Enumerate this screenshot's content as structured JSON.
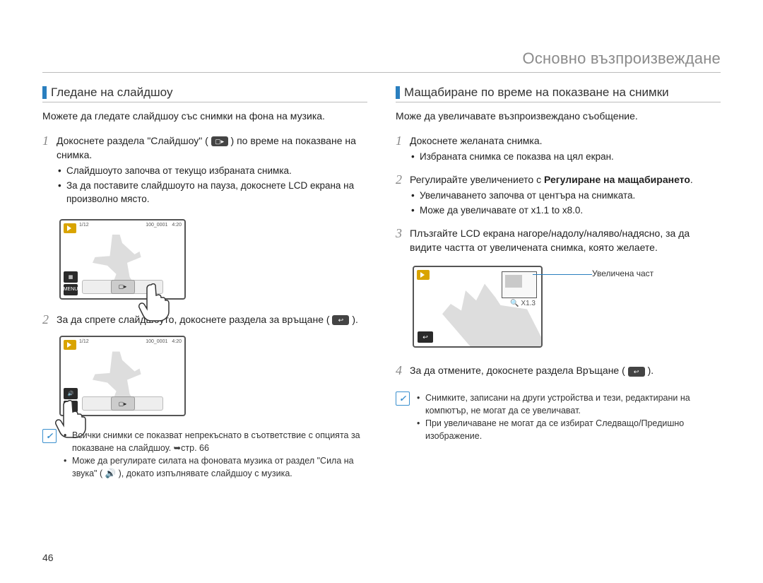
{
  "chapter_title": "Основно възпроизвеждане",
  "page_number": "46",
  "left": {
    "section_title": "Гледане на слайдшоу",
    "intro": "Можете да гледате слайдшоу със снимки на фона на музика.",
    "step1_a": "Докоснете раздела \"Слайдшоу\" (",
    "step1_b": ") по време на показване на снимка.",
    "step1_bullets": [
      "Слайдшоуто започва от текущо избраната снимка.",
      "За да поставите слайдшоуто на пауза, докоснете LCD екрана на произволно място."
    ],
    "step2_a": "За да спрете слайдшоуто, докоснете раздела за връщане (",
    "step2_b": ").",
    "note": [
      "Всички снимки се показват непрекъснато в съответствие с опцията за показване на слайдшоу. ➥стр. 66",
      "Може да регулирате силата на фоновата музика от раздел \"Сила на звука\" ( 🔊 ), докато изпълнявате слайдшоу с музика."
    ],
    "lcd": {
      "counter": "1/12",
      "file": "100_0001",
      "mem": "4:20",
      "menu_label": "MENU"
    }
  },
  "right": {
    "section_title": "Мащабиране по време на показване на снимки",
    "intro": "Може да увеличавате възпроизвеждано съобщение.",
    "step1": "Докоснете желаната снимка.",
    "step1_bullets": [
      "Избраната снимка се показва на цял екран."
    ],
    "step2_a": "Регулирайте увеличението с ",
    "step2_bold": "Регулиране на мащабирането",
    "step2_b": ".",
    "step2_bullets": [
      "Увеличаването започва от центъра на снимката.",
      "Може да увеличавате от x1.1 to x8.0."
    ],
    "step3": "Плъзгайте LCD екрана нагоре/надолу/наляво/надясно, за да видите частта от увеличената снимка, която желаете.",
    "callout": "Увеличена част",
    "zoom_label": "X1.3",
    "step4_a": "За да отмените, докоснете раздела Връщане (",
    "step4_b": ").",
    "note": [
      "Снимките, записани на други устройства и тези, редактирани на компютър, не могат да се увеличават.",
      "При увеличаване не могат да се избират Следващо/Предишно изображение."
    ]
  }
}
